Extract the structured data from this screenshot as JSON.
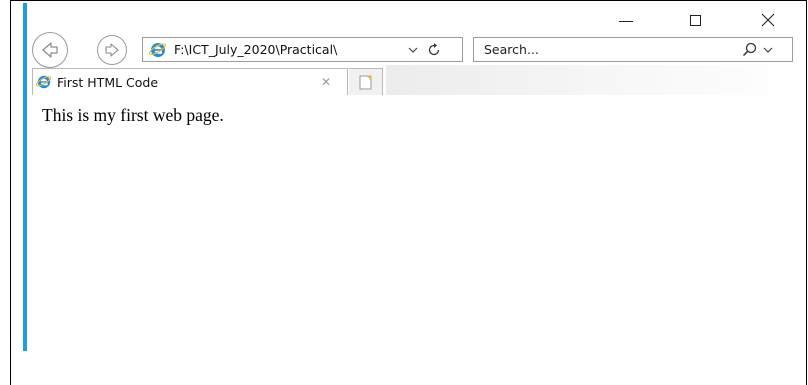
{
  "window": {
    "title_bar": {
      "minimize_icon": "minimize-icon",
      "maximize_icon": "maximize-icon",
      "close_icon": "close-icon",
      "close_glyph": "✕"
    },
    "border_color": "#1e9ee0"
  },
  "navigation": {
    "back_icon": "arrow-left-icon",
    "forward_icon": "arrow-right-icon"
  },
  "address_bar": {
    "url": "F:\\ICT_July_2020\\Practical\\",
    "favicon": "ie-logo-icon",
    "dropdown_icon": "chevron-down-icon",
    "refresh_icon": "refresh-icon"
  },
  "search": {
    "placeholder": "Search...",
    "search_icon": "magnifier-icon",
    "dropdown_icon": "chevron-down-icon"
  },
  "tabs": [
    {
      "title": "First HTML Code",
      "active": true,
      "close_glyph": "✕"
    }
  ],
  "new_tab": {
    "icon": "new-tab-icon"
  },
  "page": {
    "text": "This is my first web page."
  }
}
